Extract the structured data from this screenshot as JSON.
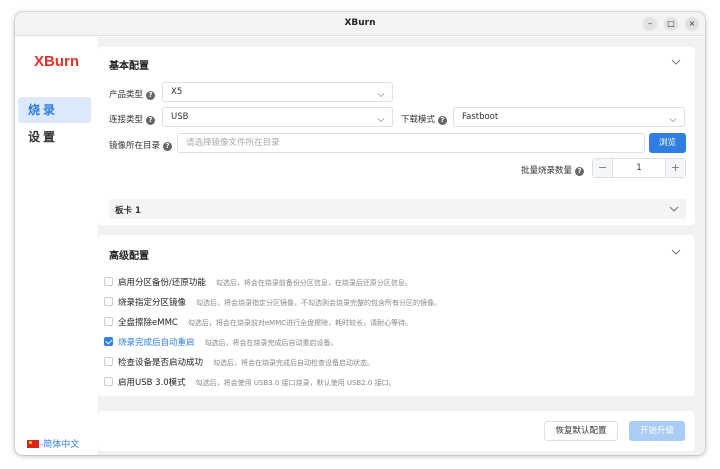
{
  "window": {
    "title": "XBurn",
    "minimize": "–",
    "maximize": "□",
    "close": "×"
  },
  "sidebar": {
    "logo": "XBurn",
    "items": [
      {
        "label": "烧录",
        "active": true
      },
      {
        "label": "设置",
        "active": false
      }
    ],
    "language": "-简体中文"
  },
  "basic": {
    "title": "基本配置",
    "product_type_label": "产品类型",
    "product_type_value": "X5",
    "connect_type_label": "连接类型",
    "connect_type_value": "USB",
    "download_mode_label": "下载模式",
    "download_mode_value": "Fastboot",
    "image_dir_label": "镜像所在目录",
    "image_dir_placeholder": "请选择镜像文件所在目录",
    "browse_label": "浏览",
    "batch_label": "批量烧录数量",
    "batch_value": "1",
    "minus": "−",
    "plus": "+",
    "board_label": "板卡 1"
  },
  "advanced": {
    "title": "高级配置",
    "options": [
      {
        "label": "启用分区备份/还原功能",
        "desc": "勾选后，将会在烧录前备份分区信息，在烧录后还原分区信息。",
        "checked": false
      },
      {
        "label": "烧录指定分区镜像",
        "desc": "勾选后，将会烧录指定分区镜像，不勾选则会烧录完整的包含所有分区的镜像。",
        "checked": false
      },
      {
        "label": "全盘擦除eMMC",
        "desc": "勾选后，将会在烧录前对eMMC进行全盘擦除，耗时较长，请耐心等待。",
        "checked": false
      },
      {
        "label": "烧录完成后自动重启",
        "desc": "勾选后，将会在烧录完成后自动重启设备。",
        "checked": true
      },
      {
        "label": "检查设备是否启动成功",
        "desc": "勾选后，将会在烧录完成后自动检查设备启动状态。",
        "checked": false
      },
      {
        "label": "启用USB 3.0模式",
        "desc": "勾选后，将会使用 USB3.0 接口烧录，默认使用 USB2.0 接口。",
        "checked": false
      }
    ]
  },
  "footer": {
    "reset_label": "恢复默认配置",
    "start_label": "开始升级"
  },
  "colors": {
    "accent": "#2f7ee0",
    "logo": "#e0352b",
    "start_disabled": "#a9cdf5"
  }
}
